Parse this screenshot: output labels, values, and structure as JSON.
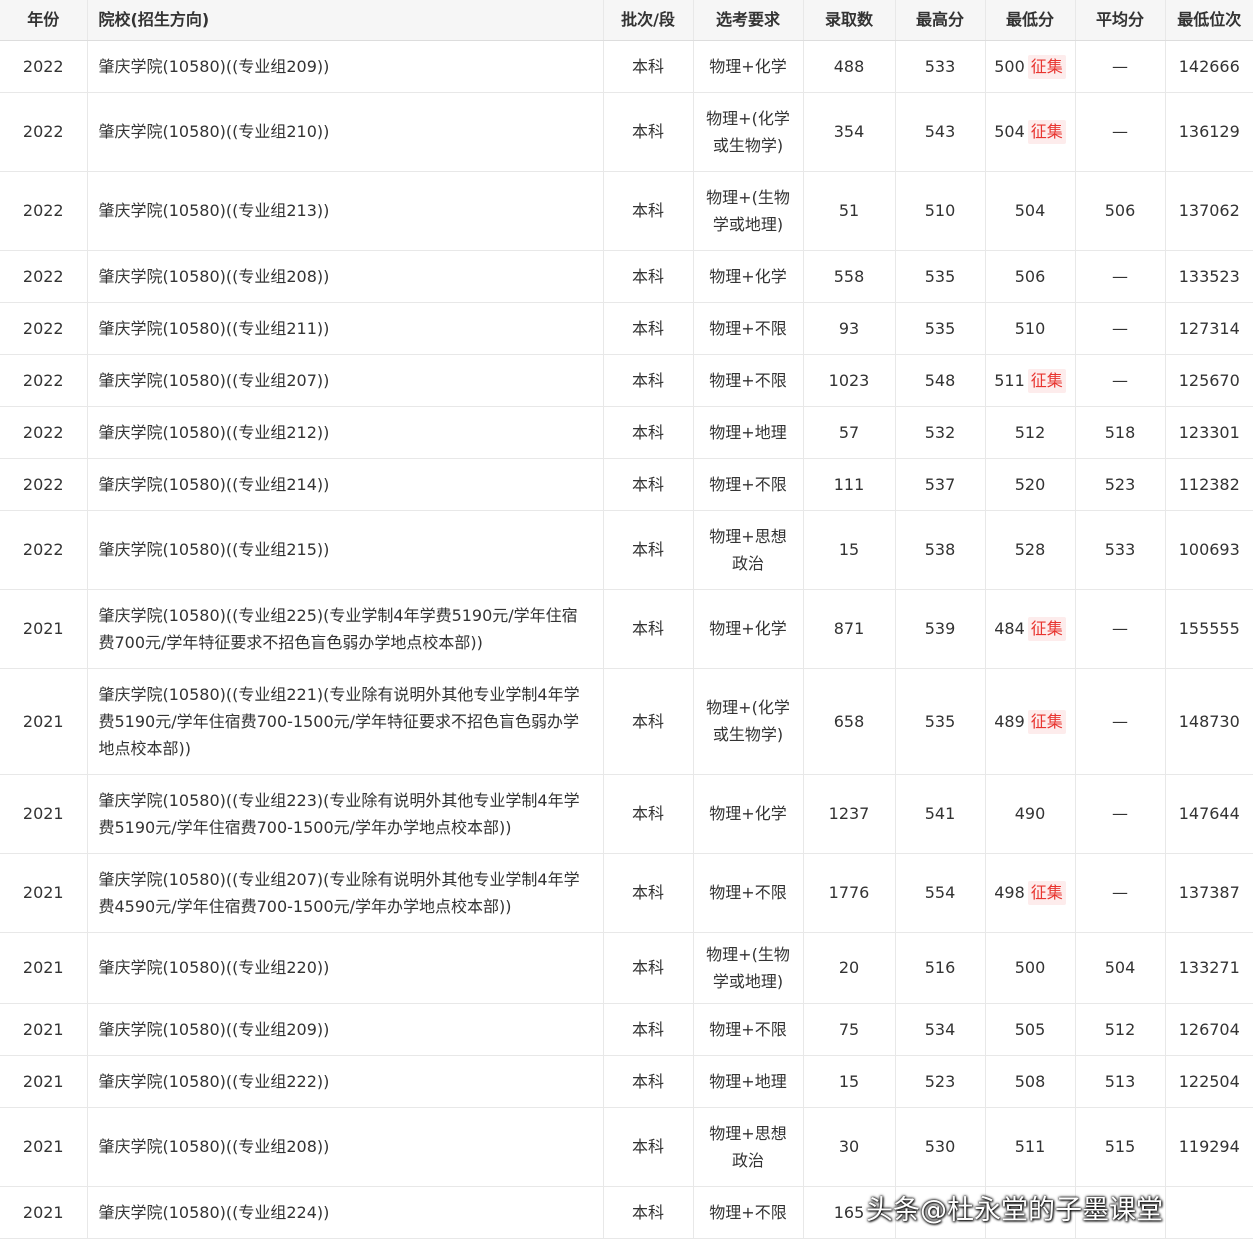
{
  "table": {
    "headers": [
      "年份",
      "院校(招生方向)",
      "批次/段",
      "选考要求",
      "录取数",
      "最高分",
      "最低分",
      "平均分",
      "最低位次"
    ],
    "badge_label": "征集",
    "rows": [
      {
        "year": "2022",
        "school": "肇庆学院(10580)((专业组209))",
        "batch": "本科",
        "req": "物理+化学",
        "admit": "488",
        "max": "533",
        "min": "500",
        "badge": true,
        "avg": "—",
        "rank": "142666"
      },
      {
        "year": "2022",
        "school": "肇庆学院(10580)((专业组210))",
        "batch": "本科",
        "req": "物理+(化学或生物学)",
        "admit": "354",
        "max": "543",
        "min": "504",
        "badge": true,
        "avg": "—",
        "rank": "136129"
      },
      {
        "year": "2022",
        "school": "肇庆学院(10580)((专业组213))",
        "batch": "本科",
        "req": "物理+(生物学或地理)",
        "admit": "51",
        "max": "510",
        "min": "504",
        "badge": false,
        "avg": "506",
        "rank": "137062"
      },
      {
        "year": "2022",
        "school": "肇庆学院(10580)((专业组208))",
        "batch": "本科",
        "req": "物理+化学",
        "admit": "558",
        "max": "535",
        "min": "506",
        "badge": false,
        "avg": "—",
        "rank": "133523"
      },
      {
        "year": "2022",
        "school": "肇庆学院(10580)((专业组211))",
        "batch": "本科",
        "req": "物理+不限",
        "admit": "93",
        "max": "535",
        "min": "510",
        "badge": false,
        "avg": "—",
        "rank": "127314"
      },
      {
        "year": "2022",
        "school": "肇庆学院(10580)((专业组207))",
        "batch": "本科",
        "req": "物理+不限",
        "admit": "1023",
        "max": "548",
        "min": "511",
        "badge": true,
        "avg": "—",
        "rank": "125670"
      },
      {
        "year": "2022",
        "school": "肇庆学院(10580)((专业组212))",
        "batch": "本科",
        "req": "物理+地理",
        "admit": "57",
        "max": "532",
        "min": "512",
        "badge": false,
        "avg": "518",
        "rank": "123301"
      },
      {
        "year": "2022",
        "school": "肇庆学院(10580)((专业组214))",
        "batch": "本科",
        "req": "物理+不限",
        "admit": "111",
        "max": "537",
        "min": "520",
        "badge": false,
        "avg": "523",
        "rank": "112382"
      },
      {
        "year": "2022",
        "school": "肇庆学院(10580)((专业组215))",
        "batch": "本科",
        "req": "物理+思想政治",
        "admit": "15",
        "max": "538",
        "min": "528",
        "badge": false,
        "avg": "533",
        "rank": "100693"
      },
      {
        "year": "2021",
        "school": "肇庆学院(10580)((专业组225)(专业学制4年学费5190元/学年住宿费700元/学年特征要求不招色盲色弱办学地点校本部))",
        "batch": "本科",
        "req": "物理+化学",
        "admit": "871",
        "max": "539",
        "min": "484",
        "badge": true,
        "avg": "—",
        "rank": "155555"
      },
      {
        "year": "2021",
        "school": "肇庆学院(10580)((专业组221)(专业除有说明外其他专业学制4年学费5190元/学年住宿费700-1500元/学年特征要求不招色盲色弱办学地点校本部))",
        "batch": "本科",
        "req": "物理+(化学或生物学)",
        "admit": "658",
        "max": "535",
        "min": "489",
        "badge": true,
        "avg": "—",
        "rank": "148730"
      },
      {
        "year": "2021",
        "school": "肇庆学院(10580)((专业组223)(专业除有说明外其他专业学制4年学费5190元/学年住宿费700-1500元/学年办学地点校本部))",
        "batch": "本科",
        "req": "物理+化学",
        "admit": "1237",
        "max": "541",
        "min": "490",
        "badge": false,
        "avg": "—",
        "rank": "147644"
      },
      {
        "year": "2021",
        "school": "肇庆学院(10580)((专业组207)(专业除有说明外其他专业学制4年学费4590元/学年住宿费700-1500元/学年办学地点校本部))",
        "batch": "本科",
        "req": "物理+不限",
        "admit": "1776",
        "max": "554",
        "min": "498",
        "badge": true,
        "avg": "—",
        "rank": "137387"
      },
      {
        "year": "2021",
        "school": "肇庆学院(10580)((专业组220))",
        "batch": "本科",
        "req": "物理+(生物学或地理)",
        "admit": "20",
        "max": "516",
        "min": "500",
        "badge": false,
        "avg": "504",
        "rank": "133271"
      },
      {
        "year": "2021",
        "school": "肇庆学院(10580)((专业组209))",
        "batch": "本科",
        "req": "物理+不限",
        "admit": "75",
        "max": "534",
        "min": "505",
        "badge": false,
        "avg": "512",
        "rank": "126704"
      },
      {
        "year": "2021",
        "school": "肇庆学院(10580)((专业组222))",
        "batch": "本科",
        "req": "物理+地理",
        "admit": "15",
        "max": "523",
        "min": "508",
        "badge": false,
        "avg": "513",
        "rank": "122504"
      },
      {
        "year": "2021",
        "school": "肇庆学院(10580)((专业组208))",
        "batch": "本科",
        "req": "物理+思想政治",
        "admit": "30",
        "max": "530",
        "min": "511",
        "badge": false,
        "avg": "515",
        "rank": "119294"
      },
      {
        "year": "2021",
        "school": "肇庆学院(10580)((专业组224))",
        "batch": "本科",
        "req": "物理+不限",
        "admit": "165",
        "max": "",
        "min": "",
        "badge": false,
        "avg": "",
        "rank": ""
      }
    ]
  },
  "watermark": "头条@杜永堂的子墨课堂"
}
